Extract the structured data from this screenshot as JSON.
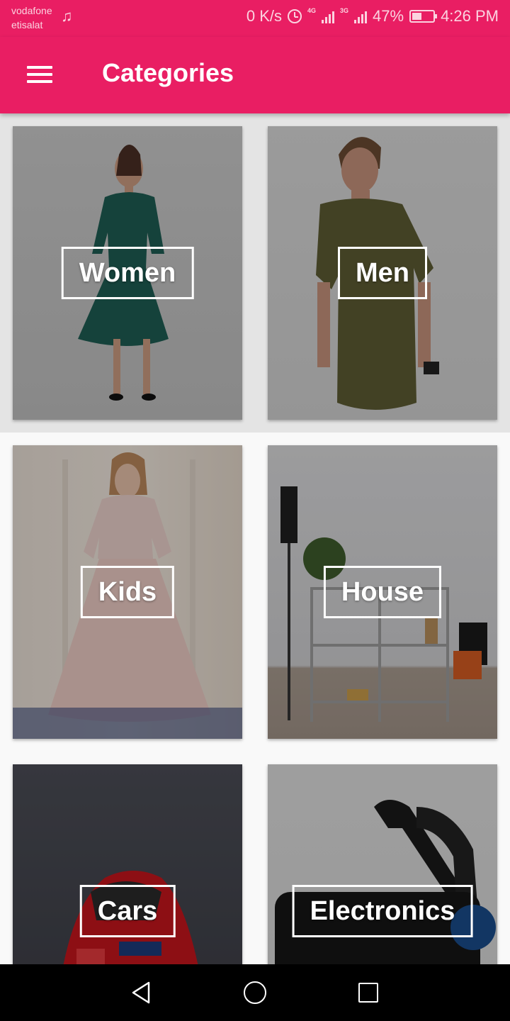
{
  "status_bar": {
    "carrier_line1": "vodafone",
    "carrier_line2": "etisalat",
    "net_speed": "0 K/s",
    "network1": "4G",
    "network2": "3G",
    "battery": "47%",
    "battery_level": 0.47,
    "time": "4:26 PM"
  },
  "app_bar": {
    "title": "Categories",
    "menu_icon": "hamburger-menu-icon",
    "background": "#e91e63"
  },
  "categories": [
    {
      "label": "Women",
      "image": "woman-in-green-dress-photo"
    },
    {
      "label": "Men",
      "image": "man-in-olive-tshirt-photo"
    },
    {
      "label": "Kids",
      "image": "girl-in-pink-gown-photo"
    },
    {
      "label": "House",
      "image": "living-room-shelf-photo"
    },
    {
      "label": "Cars",
      "image": "red-sports-car-photo"
    },
    {
      "label": "Electronics",
      "image": "vr-headset-photo"
    }
  ],
  "nav_bar": {
    "back_icon": "back-triangle-icon",
    "home_icon": "home-circle-icon",
    "recents_icon": "recents-square-icon"
  }
}
